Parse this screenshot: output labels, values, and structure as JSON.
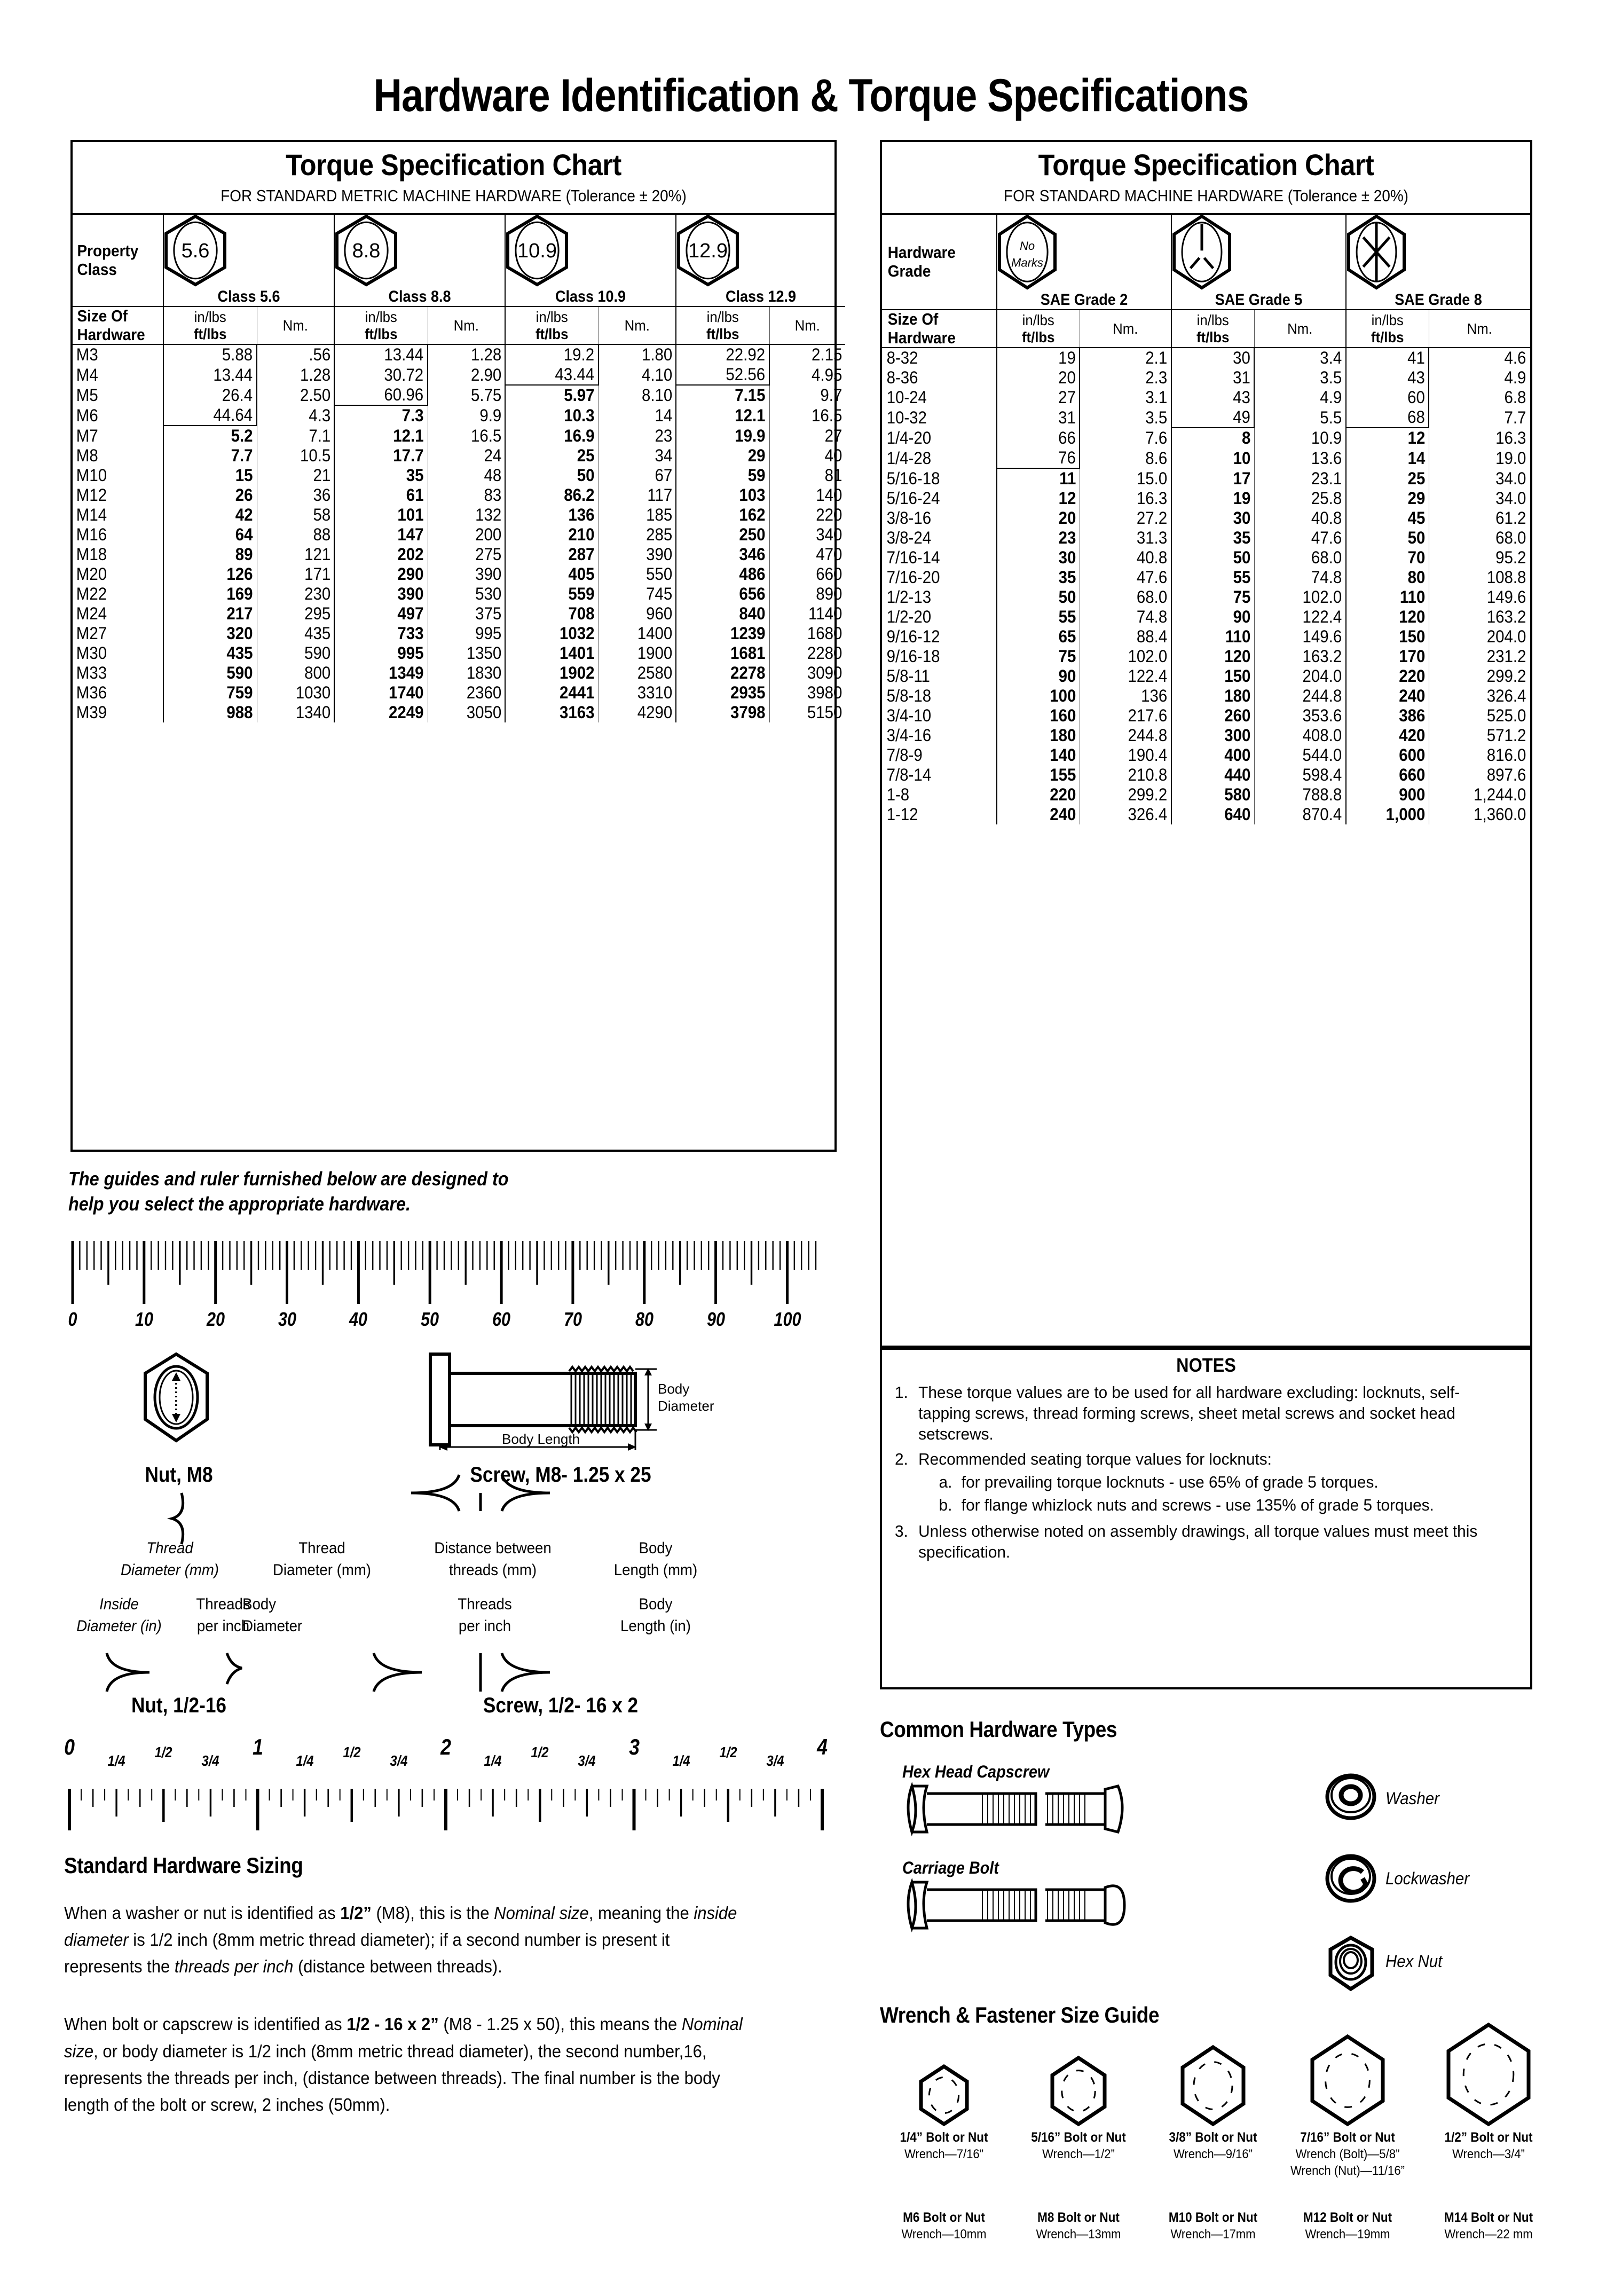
{
  "document": {
    "title": "Hardware Identification  &  Torque Specifications"
  },
  "metric_table": {
    "title": "Torque Specification Chart",
    "subtitle": "FOR STANDARD METRIC MACHINE HARDWARE (Tolerance ± 20%)",
    "row_header_1": "Property",
    "row_header_2": "Class",
    "size_header_1": "Size Of",
    "size_header_2": "Hardware",
    "unit_in": "in/lbs",
    "unit_ft": "ft/lbs",
    "unit_nm": "Nm.",
    "classes": [
      {
        "mark": "5.6",
        "label": "Class 5.6"
      },
      {
        "mark": "8.8",
        "label": "Class 8.8"
      },
      {
        "mark": "10.9",
        "label": "Class 10.9"
      },
      {
        "mark": "12.9",
        "label": "Class 12.9"
      }
    ]
  },
  "sae_table": {
    "title": "Torque Specification Chart",
    "subtitle": "FOR STANDARD MACHINE HARDWARE (Tolerance ± 20%)",
    "row_header_1": "Hardware",
    "row_header_2": "Grade",
    "size_header_1": "Size Of",
    "size_header_2": "Hardware",
    "unit_in": "in/lbs",
    "unit_ft": "ft/lbs",
    "unit_nm": "Nm.",
    "grades": [
      {
        "mark": "No Marks",
        "label": "SAE Grade 2"
      },
      {
        "mark": "grade5-marks",
        "label": "SAE Grade 5"
      },
      {
        "mark": "grade8-marks",
        "label": "SAE Grade 8"
      }
    ]
  },
  "chart_data": [
    {
      "type": "table",
      "title": "Torque Specification Chart",
      "subtitle": "FOR STANDARD METRIC MACHINE HARDWARE (Tolerance ± 20%)",
      "columns": [
        "Size Of Hardware",
        "Class 5.6 in/lbs ft/lbs",
        "Class 5.6 Nm.",
        "Class 8.8 in/lbs ft/lbs",
        "Class 8.8 Nm.",
        "Class 10.9 in/lbs ft/lbs",
        "Class 10.9 Nm.",
        "Class 12.9 in/lbs ft/lbs",
        "Class 12.9 Nm."
      ],
      "rows": [
        {
          "size": "M3",
          "c56": "5.88",
          "c56b": false,
          "n56": ".56",
          "c88": "13.44",
          "c88b": false,
          "n88": "1.28",
          "c109": "19.2",
          "c109b": false,
          "n109": "1.80",
          "c129": "22.92",
          "c129b": false,
          "n129": "2.15"
        },
        {
          "size": "M4",
          "c56": "13.44",
          "c56b": false,
          "n56": "1.28",
          "c88": "30.72",
          "c88b": false,
          "n88": "2.90",
          "c109": "43.44",
          "c109b": false,
          "n109": "4.10",
          "c129": "52.56",
          "c129b": false,
          "n129": "4.95"
        },
        {
          "size": "M5",
          "c56": "26.4",
          "c56b": false,
          "n56": "2.50",
          "c88": "60.96",
          "c88b": false,
          "n88": "5.75",
          "c109": "5.97",
          "c109b": true,
          "n109": "8.10",
          "c129": "7.15",
          "c129b": true,
          "n129": "9.7"
        },
        {
          "size": "M6",
          "c56": "44.64",
          "c56b": false,
          "n56": "4.3",
          "c88": "7.3",
          "c88b": true,
          "n88": "9.9",
          "c109": "10.3",
          "c109b": true,
          "n109": "14",
          "c129": "12.1",
          "c129b": true,
          "n129": "16.5"
        },
        {
          "size": "M7",
          "c56": "5.2",
          "c56b": true,
          "n56": "7.1",
          "c88": "12.1",
          "c88b": true,
          "n88": "16.5",
          "c109": "16.9",
          "c109b": true,
          "n109": "23",
          "c129": "19.9",
          "c129b": true,
          "n129": "27"
        },
        {
          "size": "M8",
          "c56": "7.7",
          "c56b": true,
          "n56": "10.5",
          "c88": "17.7",
          "c88b": true,
          "n88": "24",
          "c109": "25",
          "c109b": true,
          "n109": "34",
          "c129": "29",
          "c129b": true,
          "n129": "40"
        },
        {
          "size": "M10",
          "c56": "15",
          "c56b": true,
          "n56": "21",
          "c88": "35",
          "c88b": true,
          "n88": "48",
          "c109": "50",
          "c109b": true,
          "n109": "67",
          "c129": "59",
          "c129b": true,
          "n129": "81"
        },
        {
          "size": "M12",
          "c56": "26",
          "c56b": true,
          "n56": "36",
          "c88": "61",
          "c88b": true,
          "n88": "83",
          "c109": "86.2",
          "c109b": true,
          "n109": "117",
          "c129": "103",
          "c129b": true,
          "n129": "140"
        },
        {
          "size": "M14",
          "c56": "42",
          "c56b": true,
          "n56": "58",
          "c88": "101",
          "c88b": true,
          "n88": "132",
          "c109": "136",
          "c109b": true,
          "n109": "185",
          "c129": "162",
          "c129b": true,
          "n129": "220"
        },
        {
          "size": "M16",
          "c56": "64",
          "c56b": true,
          "n56": "88",
          "c88": "147",
          "c88b": true,
          "n88": "200",
          "c109": "210",
          "c109b": true,
          "n109": "285",
          "c129": "250",
          "c129b": true,
          "n129": "340"
        },
        {
          "size": "M18",
          "c56": "89",
          "c56b": true,
          "n56": "121",
          "c88": "202",
          "c88b": true,
          "n88": "275",
          "c109": "287",
          "c109b": true,
          "n109": "390",
          "c129": "346",
          "c129b": true,
          "n129": "470"
        },
        {
          "size": "M20",
          "c56": "126",
          "c56b": true,
          "n56": "171",
          "c88": "290",
          "c88b": true,
          "n88": "390",
          "c109": "405",
          "c109b": true,
          "n109": "550",
          "c129": "486",
          "c129b": true,
          "n129": "660"
        },
        {
          "size": "M22",
          "c56": "169",
          "c56b": true,
          "n56": "230",
          "c88": "390",
          "c88b": true,
          "n88": "530",
          "c109": "559",
          "c109b": true,
          "n109": "745",
          "c129": "656",
          "c129b": true,
          "n129": "890"
        },
        {
          "size": "M24",
          "c56": "217",
          "c56b": true,
          "n56": "295",
          "c88": "497",
          "c88b": true,
          "n88": "375",
          "c109": "708",
          "c109b": true,
          "n109": "960",
          "c129": "840",
          "c129b": true,
          "n129": "1140"
        },
        {
          "size": "M27",
          "c56": "320",
          "c56b": true,
          "n56": "435",
          "c88": "733",
          "c88b": true,
          "n88": "995",
          "c109": "1032",
          "c109b": true,
          "n109": "1400",
          "c129": "1239",
          "c129b": true,
          "n129": "1680"
        },
        {
          "size": "M30",
          "c56": "435",
          "c56b": true,
          "n56": "590",
          "c88": "995",
          "c88b": true,
          "n88": "1350",
          "c109": "1401",
          "c109b": true,
          "n109": "1900",
          "c129": "1681",
          "c129b": true,
          "n129": "2280"
        },
        {
          "size": "M33",
          "c56": "590",
          "c56b": true,
          "n56": "800",
          "c88": "1349",
          "c88b": true,
          "n88": "1830",
          "c109": "1902",
          "c109b": true,
          "n109": "2580",
          "c129": "2278",
          "c129b": true,
          "n129": "3090"
        },
        {
          "size": "M36",
          "c56": "759",
          "c56b": true,
          "n56": "1030",
          "c88": "1740",
          "c88b": true,
          "n88": "2360",
          "c109": "2441",
          "c109b": true,
          "n109": "3310",
          "c129": "2935",
          "c129b": true,
          "n129": "3980"
        },
        {
          "size": "M39",
          "c56": "988",
          "c56b": true,
          "n56": "1340",
          "c88": "2249",
          "c88b": true,
          "n88": "3050",
          "c109": "3163",
          "c109b": true,
          "n109": "4290",
          "c129": "3798",
          "c129b": true,
          "n129": "5150"
        }
      ]
    },
    {
      "type": "table",
      "title": "Torque Specification Chart",
      "subtitle": "FOR STANDARD MACHINE HARDWARE (Tolerance ± 20%)",
      "columns": [
        "Size Of Hardware",
        "SAE Grade 2 in/lbs ft/lbs",
        "SAE Grade 2 Nm.",
        "SAE Grade 5 in/lbs ft/lbs",
        "SAE Grade 5 Nm.",
        "SAE Grade 8 in/lbs ft/lbs",
        "SAE Grade 8 Nm."
      ],
      "rows": [
        {
          "size": "8-32",
          "g2": "19",
          "g2b": false,
          "n2": "2.1",
          "g5": "30",
          "g5b": false,
          "n5": "3.4",
          "g8": "41",
          "g8b": false,
          "n8": "4.6"
        },
        {
          "size": "8-36",
          "g2": "20",
          "g2b": false,
          "n2": "2.3",
          "g5": "31",
          "g5b": false,
          "n5": "3.5",
          "g8": "43",
          "g8b": false,
          "n8": "4.9"
        },
        {
          "size": "10-24",
          "g2": "27",
          "g2b": false,
          "n2": "3.1",
          "g5": "43",
          "g5b": false,
          "n5": "4.9",
          "g8": "60",
          "g8b": false,
          "n8": "6.8"
        },
        {
          "size": "10-32",
          "g2": "31",
          "g2b": false,
          "n2": "3.5",
          "g5": "49",
          "g5b": false,
          "n5": "5.5",
          "g8": "68",
          "g8b": false,
          "n8": "7.7"
        },
        {
          "size": "1/4-20",
          "g2": "66",
          "g2b": false,
          "n2": "7.6",
          "g5": "8",
          "g5b": true,
          "n5": "10.9",
          "g8": "12",
          "g8b": true,
          "n8": "16.3"
        },
        {
          "size": "1/4-28",
          "g2": "76",
          "g2b": false,
          "n2": "8.6",
          "g5": "10",
          "g5b": true,
          "n5": "13.6",
          "g8": "14",
          "g8b": true,
          "n8": "19.0"
        },
        {
          "size": "5/16-18",
          "g2": "11",
          "g2b": true,
          "n2": "15.0",
          "g5": "17",
          "g5b": true,
          "n5": "23.1",
          "g8": "25",
          "g8b": true,
          "n8": "34.0"
        },
        {
          "size": "5/16-24",
          "g2": "12",
          "g2b": true,
          "n2": "16.3",
          "g5": "19",
          "g5b": true,
          "n5": "25.8",
          "g8": "29",
          "g8b": true,
          "n8": "34.0"
        },
        {
          "size": "3/8-16",
          "g2": "20",
          "g2b": true,
          "n2": "27.2",
          "g5": "30",
          "g5b": true,
          "n5": "40.8",
          "g8": "45",
          "g8b": true,
          "n8": "61.2"
        },
        {
          "size": "3/8-24",
          "g2": "23",
          "g2b": true,
          "n2": "31.3",
          "g5": "35",
          "g5b": true,
          "n5": "47.6",
          "g8": "50",
          "g8b": true,
          "n8": "68.0"
        },
        {
          "size": "7/16-14",
          "g2": "30",
          "g2b": true,
          "n2": "40.8",
          "g5": "50",
          "g5b": true,
          "n5": "68.0",
          "g8": "70",
          "g8b": true,
          "n8": "95.2"
        },
        {
          "size": "7/16-20",
          "g2": "35",
          "g2b": true,
          "n2": "47.6",
          "g5": "55",
          "g5b": true,
          "n5": "74.8",
          "g8": "80",
          "g8b": true,
          "n8": "108.8"
        },
        {
          "size": "1/2-13",
          "g2": "50",
          "g2b": true,
          "n2": "68.0",
          "g5": "75",
          "g5b": true,
          "n5": "102.0",
          "g8": "110",
          "g8b": true,
          "n8": "149.6"
        },
        {
          "size": "1/2-20",
          "g2": "55",
          "g2b": true,
          "n2": "74.8",
          "g5": "90",
          "g5b": true,
          "n5": "122.4",
          "g8": "120",
          "g8b": true,
          "n8": "163.2"
        },
        {
          "size": "9/16-12",
          "g2": "65",
          "g2b": true,
          "n2": "88.4",
          "g5": "110",
          "g5b": true,
          "n5": "149.6",
          "g8": "150",
          "g8b": true,
          "n8": "204.0"
        },
        {
          "size": "9/16-18",
          "g2": "75",
          "g2b": true,
          "n2": "102.0",
          "g5": "120",
          "g5b": true,
          "n5": "163.2",
          "g8": "170",
          "g8b": true,
          "n8": "231.2"
        },
        {
          "size": "5/8-11",
          "g2": "90",
          "g2b": true,
          "n2": "122.4",
          "g5": "150",
          "g5b": true,
          "n5": "204.0",
          "g8": "220",
          "g8b": true,
          "n8": "299.2"
        },
        {
          "size": "5/8-18",
          "g2": "100",
          "g2b": true,
          "n2": "136",
          "g5": "180",
          "g5b": true,
          "n5": "244.8",
          "g8": "240",
          "g8b": true,
          "n8": "326.4"
        },
        {
          "size": "3/4-10",
          "g2": "160",
          "g2b": true,
          "n2": "217.6",
          "g5": "260",
          "g5b": true,
          "n5": "353.6",
          "g8": "386",
          "g8b": true,
          "n8": "525.0"
        },
        {
          "size": "3/4-16",
          "g2": "180",
          "g2b": true,
          "n2": "244.8",
          "g5": "300",
          "g5b": true,
          "n5": "408.0",
          "g8": "420",
          "g8b": true,
          "n8": "571.2"
        },
        {
          "size": "7/8-9",
          "g2": "140",
          "g2b": true,
          "n2": "190.4",
          "g5": "400",
          "g5b": true,
          "n5": "544.0",
          "g8": "600",
          "g8b": true,
          "n8": "816.0"
        },
        {
          "size": "7/8-14",
          "g2": "155",
          "g2b": true,
          "n2": "210.8",
          "g5": "440",
          "g5b": true,
          "n5": "598.4",
          "g8": "660",
          "g8b": true,
          "n8": "897.6"
        },
        {
          "size": "1-8",
          "g2": "220",
          "g2b": true,
          "n2": "299.2",
          "g5": "580",
          "g5b": true,
          "n5": "788.8",
          "g8": "900",
          "g8b": true,
          "n8": "1,244.0"
        },
        {
          "size": "1-12",
          "g2": "240",
          "g2b": true,
          "n2": "326.4",
          "g5": "640",
          "g5b": true,
          "n5": "870.4",
          "g8": "1,000",
          "g8b": true,
          "n8": "1,360.0"
        }
      ]
    }
  ],
  "notes": {
    "title": "NOTES",
    "items": [
      {
        "num": "1.",
        "text": "These torque values are to be used for all hardware excluding: locknuts, self-tapping screws, thread forming screws, sheet metal screws and socket head setscrews."
      },
      {
        "num": "2.",
        "text": "Recommended seating torque values for locknuts:",
        "sub": [
          {
            "num": "a.",
            "text": "for prevailing torque locknuts - use 65% of grade 5 torques."
          },
          {
            "num": "b.",
            "text": "for flange whizlock nuts and screws - use 135% of grade 5 torques."
          }
        ]
      },
      {
        "num": "3.",
        "text": "Unless otherwise noted on assembly drawings, all torque values must meet this specification."
      }
    ]
  },
  "guides": {
    "intro_line1": "The guides and ruler furnished below are designed to",
    "intro_line2": "help you select the appropriate hardware.",
    "mm_ruler": {
      "ticks": [
        "0",
        "10",
        "20",
        "30",
        "40",
        "50",
        "60",
        "70",
        "80",
        "90",
        "100"
      ]
    },
    "inch_ruler": {
      "whole": [
        "0",
        "1",
        "2",
        "3",
        "4"
      ],
      "fractions": [
        "1/4",
        "1/2",
        "3/4"
      ]
    },
    "nut_metric_label": "Nut, M8",
    "screw_metric_label": "Screw, M8- 1.25 x 25",
    "nut_inch_label": "Nut, 1/2-16",
    "screw_inch_label": "Screw, 1/2- 16 x 2",
    "bolt_callouts": {
      "body_diameter": "Body\nDiameter",
      "body_length": "Body Length"
    },
    "nut_upper": [
      "Thread",
      "Diameter (mm)"
    ],
    "nut_lower": [
      [
        "Inside",
        "Diameter (in)"
      ],
      [
        "Threads",
        "per inch"
      ]
    ],
    "screw_upper": [
      [
        "Thread",
        "Diameter (mm)"
      ],
      [
        "Distance between",
        "threads (mm)"
      ],
      [
        "Body",
        "Length (mm)"
      ]
    ],
    "screw_lower": [
      [
        "Body",
        "Diameter"
      ],
      [
        "Threads",
        "per inch"
      ],
      [
        "Body",
        "Length (in)"
      ]
    ]
  },
  "sizing": {
    "heading": "Standard Hardware Sizing",
    "para1_a": "When a washer or nut is identified as ",
    "para1_b": "1/2”",
    "para1_c": " (M8), this is the ",
    "para1_d": "Nominal size",
    "para1_e": ", meaning the ",
    "para1_f": "inside diameter",
    "para1_g": " is 1/2 inch (8mm metric thread diameter); if a second number is present it represents the ",
    "para1_h": "threads per inch",
    "para1_i": " (distance between threads).",
    "para2_a": "When bolt or capscrew is identified as ",
    "para2_b": "1/2 - 16 x 2”",
    "para2_c": " (M8 - 1.25 x 50), this means the ",
    "para2_d": "Nominal size",
    "para2_e": ", or body diameter is 1/2 inch (8mm metric thread diameter), the second number,16, represents the threads per inch, (distance between threads).  The final number is the body length of the bolt or screw, 2 inches (50mm)."
  },
  "hardware_types": {
    "heading": "Common Hardware Types",
    "items": [
      {
        "name": "Hex Head Capscrew"
      },
      {
        "name": "Carriage Bolt"
      },
      {
        "name": "Washer"
      },
      {
        "name": "Lockwasher"
      },
      {
        "name": "Hex Nut"
      }
    ]
  },
  "wrench_guide": {
    "heading": "Wrench & Fastener Size Guide",
    "inch_row": [
      {
        "title": "1/4” Bolt or Nut",
        "sub1": "Wrench—7/16”",
        "sub2": ""
      },
      {
        "title": "5/16” Bolt or Nut",
        "sub1": "Wrench—1/2”",
        "sub2": ""
      },
      {
        "title": "3/8” Bolt or Nut",
        "sub1": "Wrench—9/16”",
        "sub2": ""
      },
      {
        "title": "7/16” Bolt or Nut",
        "sub1": "Wrench (Bolt)—5/8”",
        "sub2": "Wrench (Nut)—11/16”"
      },
      {
        "title": "1/2” Bolt or Nut",
        "sub1": "Wrench—3/4”",
        "sub2": ""
      }
    ],
    "metric_row": [
      {
        "title": "M6 Bolt or Nut",
        "sub1": "Wrench—10mm"
      },
      {
        "title": "M8 Bolt or Nut",
        "sub1": "Wrench—13mm"
      },
      {
        "title": "M10 Bolt or Nut",
        "sub1": "Wrench—17mm"
      },
      {
        "title": "M12 Bolt or Nut",
        "sub1": "Wrench—19mm"
      },
      {
        "title": "M14 Bolt or Nut",
        "sub1": "Wrench—22 mm"
      }
    ]
  }
}
